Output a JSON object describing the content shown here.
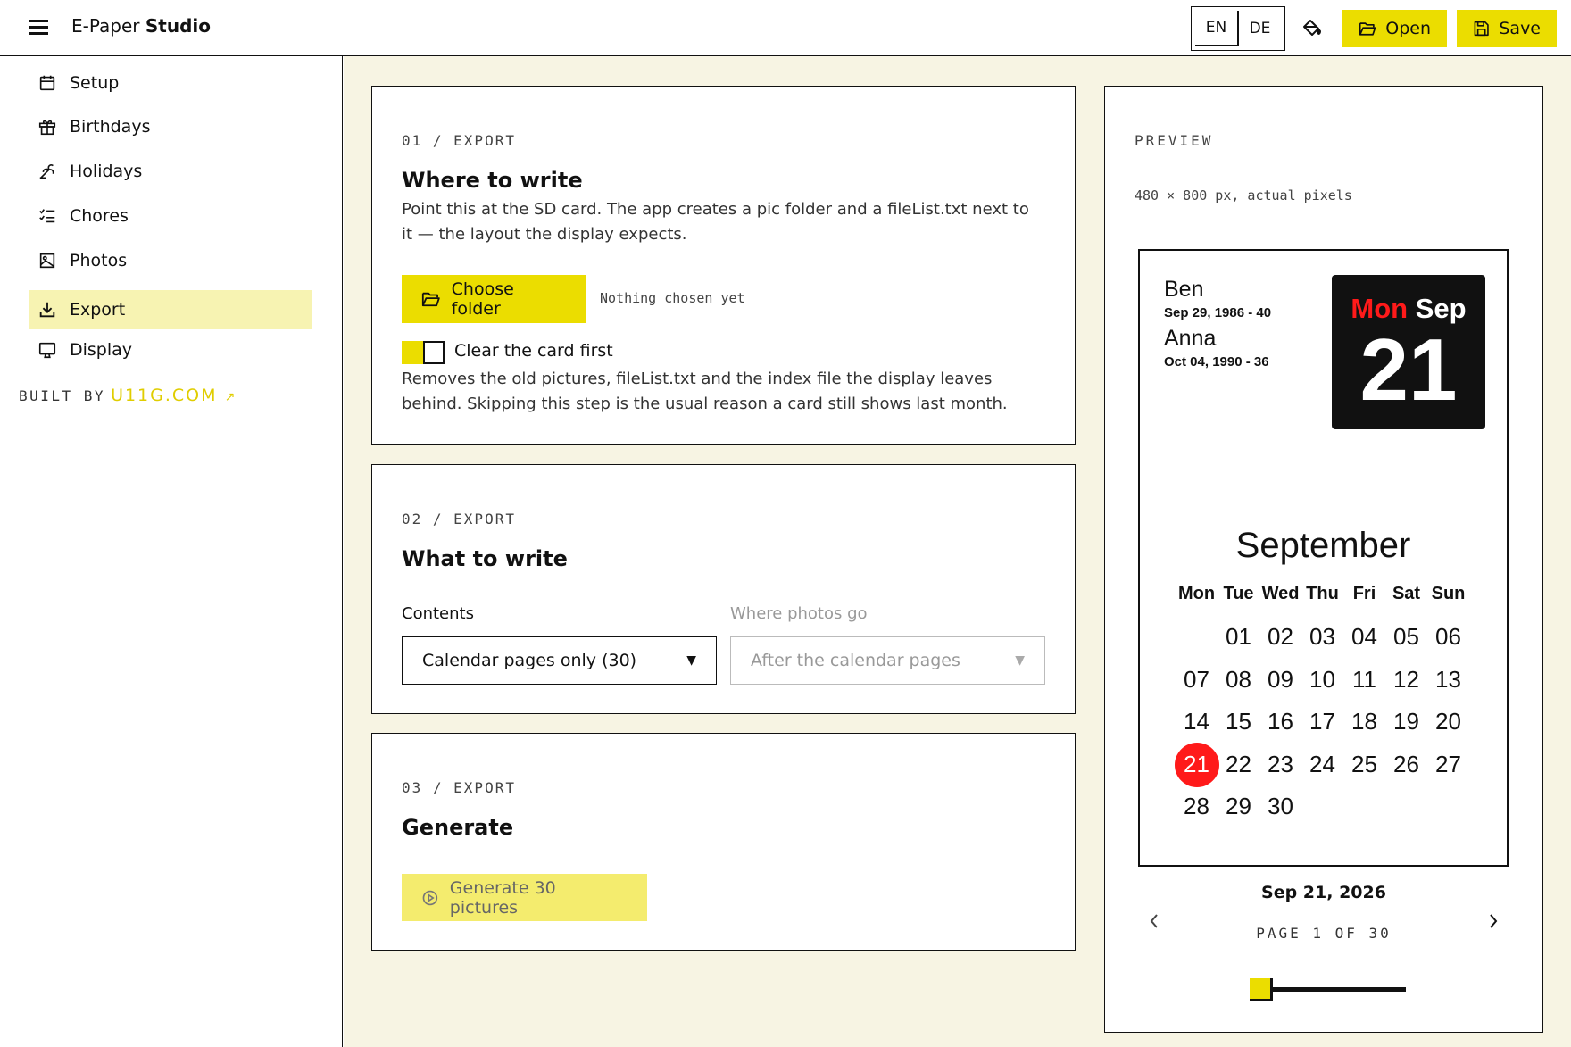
{
  "header": {
    "brand_prefix": "E-Paper",
    "brand_bold": "Studio",
    "lang_en": "EN",
    "lang_de": "DE",
    "open_label": "Open",
    "save_label": "Save"
  },
  "sidebar": {
    "items": [
      {
        "label": "Setup",
        "icon": "calendar-icon"
      },
      {
        "label": "Birthdays",
        "icon": "gift-icon"
      },
      {
        "label": "Holidays",
        "icon": "palm-tree-icon"
      },
      {
        "label": "Chores",
        "icon": "checklist-icon"
      },
      {
        "label": "Photos",
        "icon": "image-icon"
      },
      {
        "label": "Export",
        "icon": "download-icon"
      },
      {
        "label": "Display",
        "icon": "monitor-icon"
      }
    ],
    "active": "Export",
    "built_by": "BUILT BY",
    "built_link": "U11G.COM",
    "built_arrow": "↗"
  },
  "card1": {
    "eyebrow": "01 / EXPORT",
    "title": "Where to write",
    "desc": "Point this at the SD card. The app creates a pic folder and a fileList.txt next to it — the layout the display expects.",
    "button": "Choose folder",
    "note": "Nothing chosen yet",
    "toggle_label": "Clear the card first",
    "toggle_on": true,
    "toggle_desc": "Removes the old pictures, fileList.txt and the index file the display leaves behind. Skipping this step is the usual reason a card still shows last month."
  },
  "card2": {
    "eyebrow": "02 / EXPORT",
    "title": "What to write",
    "contents_label": "Contents",
    "contents_value": "Calendar pages only (30)",
    "photos_label": "Where photos go",
    "photos_value": "After the calendar pages"
  },
  "card3": {
    "eyebrow": "03 / EXPORT",
    "title": "Generate",
    "button": "Generate 30 pictures"
  },
  "preview": {
    "eyebrow": "PREVIEW",
    "size_note": "480 × 800 px, actual pixels",
    "birthdays": [
      {
        "name": "Ben",
        "date": "Sep 29, 1986 - 40"
      },
      {
        "name": "Anna",
        "date": "Oct 04, 1990 - 36"
      }
    ],
    "weekday_short": "Mon",
    "month_short": "Sep",
    "day_number": "21",
    "month_name": "September",
    "weekdays": [
      "Mon",
      "Tue",
      "Wed",
      "Thu",
      "Fri",
      "Sat",
      "Sun"
    ],
    "first_weekday_index": 1,
    "days": [
      "01",
      "02",
      "03",
      "04",
      "05",
      "06",
      "07",
      "08",
      "09",
      "10",
      "11",
      "12",
      "13",
      "14",
      "15",
      "16",
      "17",
      "18",
      "19",
      "20",
      "21",
      "22",
      "23",
      "24",
      "25",
      "26",
      "27",
      "28",
      "29",
      "30"
    ],
    "today": "21",
    "date_label": "Sep 21, 2026",
    "page_label": "PAGE 1 OF 30",
    "page_current": 1,
    "page_total": 30,
    "colors": {
      "accent": "#ebdd00",
      "today": "#ff1a1a"
    }
  }
}
